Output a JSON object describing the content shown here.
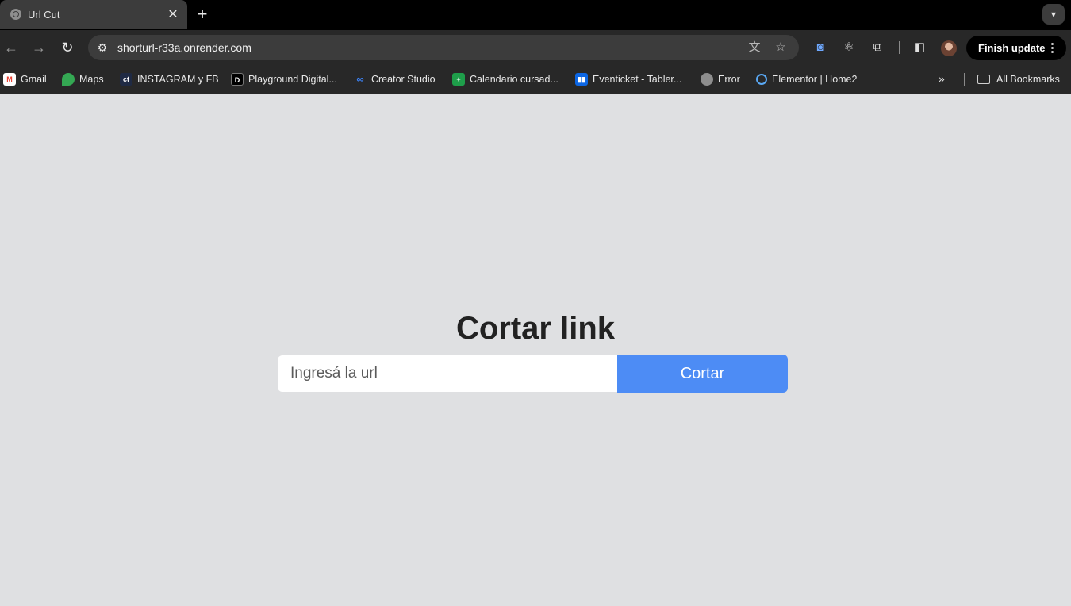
{
  "tab": {
    "title": "Url Cut",
    "close": "✕",
    "new_tab": "+"
  },
  "toolbar": {
    "url": "shorturl-r33a.onrender.com",
    "finish_update": "Finish update"
  },
  "bookmarks": [
    {
      "label": "Gmail",
      "icon": "gmail-icon",
      "color": "#ea4335"
    },
    {
      "label": "Maps",
      "icon": "maps-icon",
      "color": "#34a853"
    },
    {
      "label": "INSTAGRAM y FB",
      "icon": "ct-icon",
      "color": "#1f2a44"
    },
    {
      "label": "Playground Digital...",
      "icon": "playground-icon",
      "color": "#000000"
    },
    {
      "label": "Creator Studio",
      "icon": "meta-icon",
      "color": "#0a66ff"
    },
    {
      "label": "Calendario cursad...",
      "icon": "sheets-icon",
      "color": "#1e9e4a"
    },
    {
      "label": "Eventicket - Tabler...",
      "icon": "trello-icon",
      "color": "#0c66e4"
    },
    {
      "label": "Error",
      "icon": "globe-icon",
      "color": "#8e8e8e"
    },
    {
      "label": "Elementor | Home2",
      "icon": "elementor-icon",
      "color": "#5aa9f5"
    }
  ],
  "all_bookmarks": "All Bookmarks",
  "page": {
    "heading": "Cortar link",
    "input_placeholder": "Ingresá la url",
    "button_label": "Cortar"
  },
  "colors": {
    "button": "#4d8cf5",
    "page_bg": "#dfe0e2"
  }
}
